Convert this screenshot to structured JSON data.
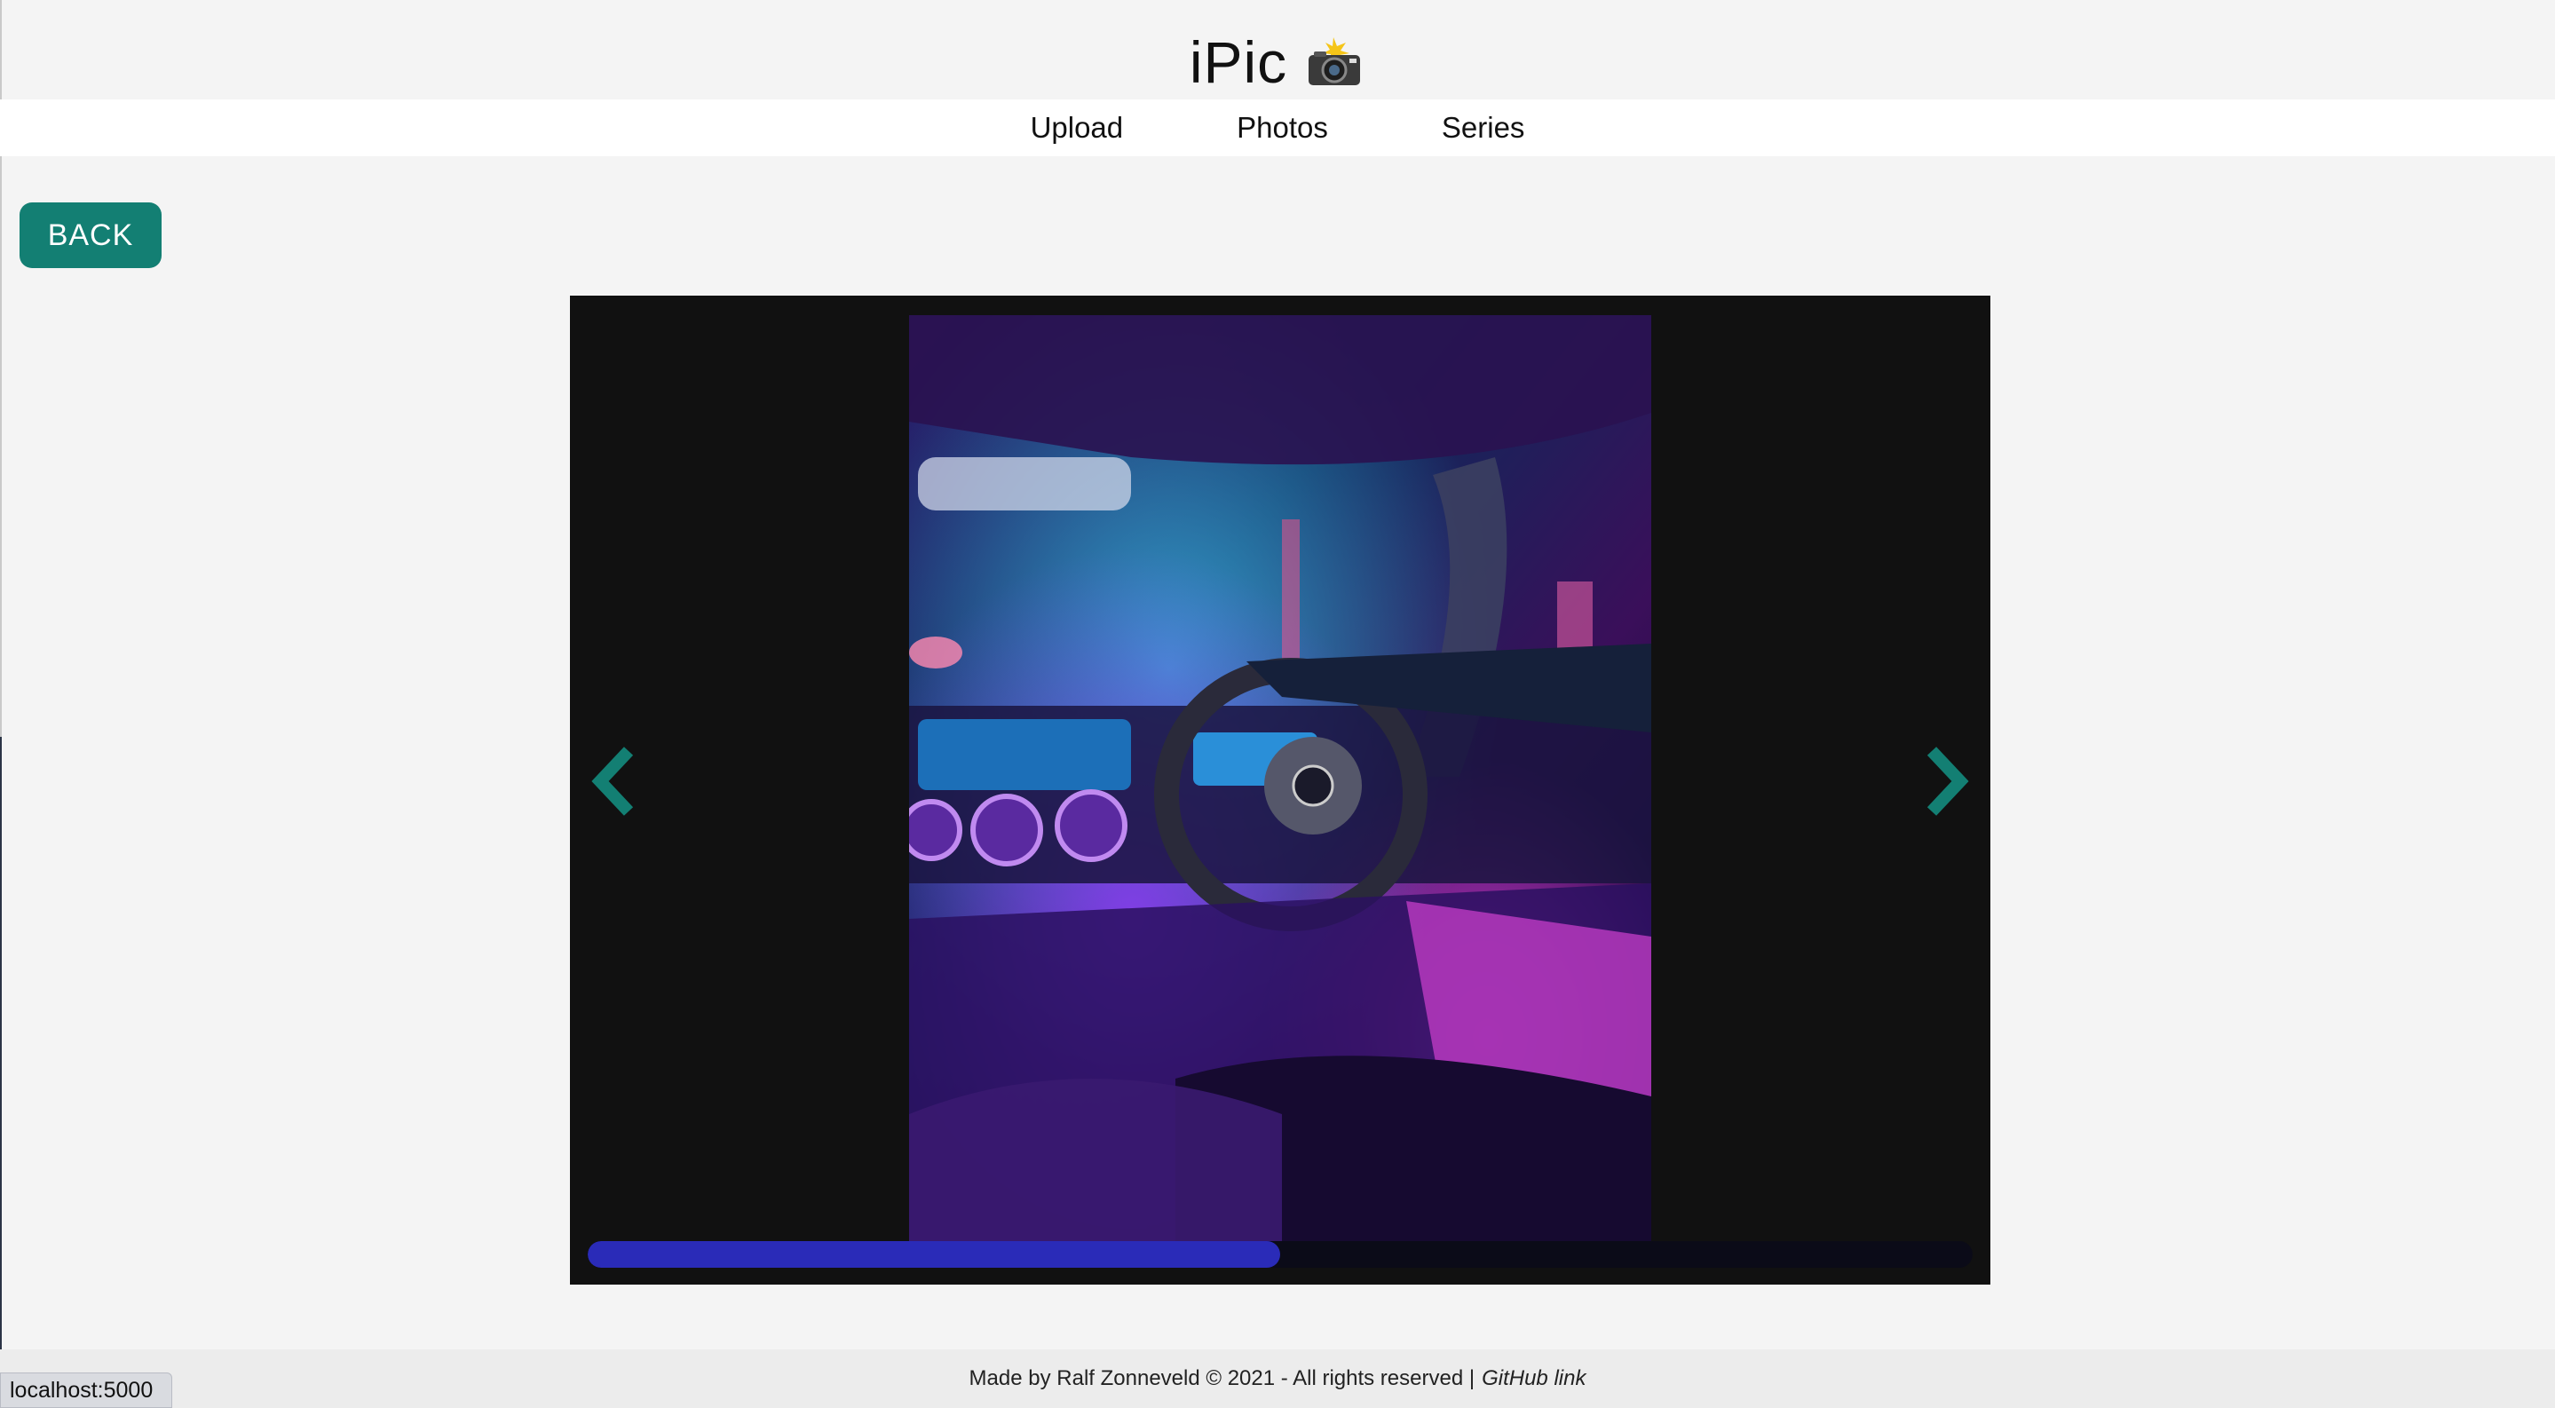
{
  "header": {
    "title": "iPic",
    "title_icon": "camera-flash-icon"
  },
  "nav": {
    "items": [
      {
        "label": "Upload"
      },
      {
        "label": "Photos"
      },
      {
        "label": "Series"
      }
    ]
  },
  "actions": {
    "back_label": "BACK"
  },
  "viewer": {
    "prev_icon": "chevron-left-icon",
    "next_icon": "chevron-right-icon",
    "progress": 0.5,
    "photo_subject": "car-interior-photo"
  },
  "footer": {
    "text": "Made by Ralf Zonneveld © 2021 - All rights reserved |",
    "link_label": "GitHub link"
  },
  "browser": {
    "status_url": "localhost:5000"
  },
  "colors": {
    "accent": "#137f73",
    "progress": "#2a2bb8",
    "viewer_bg": "#111111",
    "page_bg": "#f4f4f4"
  }
}
